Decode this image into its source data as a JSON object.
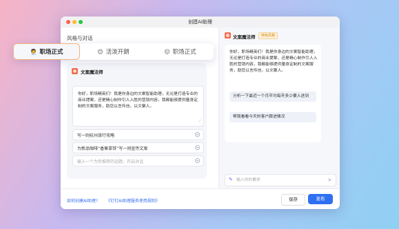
{
  "window": {
    "title": "创建AI助理"
  },
  "style_section": {
    "label": "风格与对话"
  },
  "tabs": [
    {
      "label": "职场正式",
      "icon": "🧑‍💼"
    },
    {
      "label": "活泼开朗",
      "icon": "😊"
    },
    {
      "label": "职场正式",
      "icon": "😌"
    }
  ],
  "preview_card": {
    "name": "文案魔法师",
    "intro": "你好，职场精英们！我是你身边的文案智能助理，无论是打造专业的商业提案，还是精心制作引人入胜的营销内容，我都能够提供量身定制的文案服务，助您以言传信，以文聚人。",
    "questions": [
      "写一则杭州旅行攻略",
      "为新品咖啡“香蕉拿铁”写一则宣传文案"
    ],
    "question_placeholder": "输入一个为你推荐的话题，开启对话"
  },
  "chat_preview": {
    "name": "文案魔法师",
    "badge": "特色风格",
    "message": "你好，职场精英们！我是你身边的文案智能助理，无论是打造专业的商业提案，还是精心制作引人入胜的营销内容，我都能够提供量身定制的文案服务，助您以言传信，以文聚人。",
    "suggestions": [
      "分析一下最近一个月平均每天多少要人进到",
      "帮我看看今天的客户跟进情况"
    ],
    "input_placeholder": "输入你的要求"
  },
  "footer": {
    "link1": "如何创建AI助理?",
    "link2": "《钉钉AI助理服务使用规则》",
    "save": "保存",
    "publish": "发布"
  },
  "colors": {
    "accent": "#2f6ff2",
    "tab_highlight": "#f2b27b"
  }
}
